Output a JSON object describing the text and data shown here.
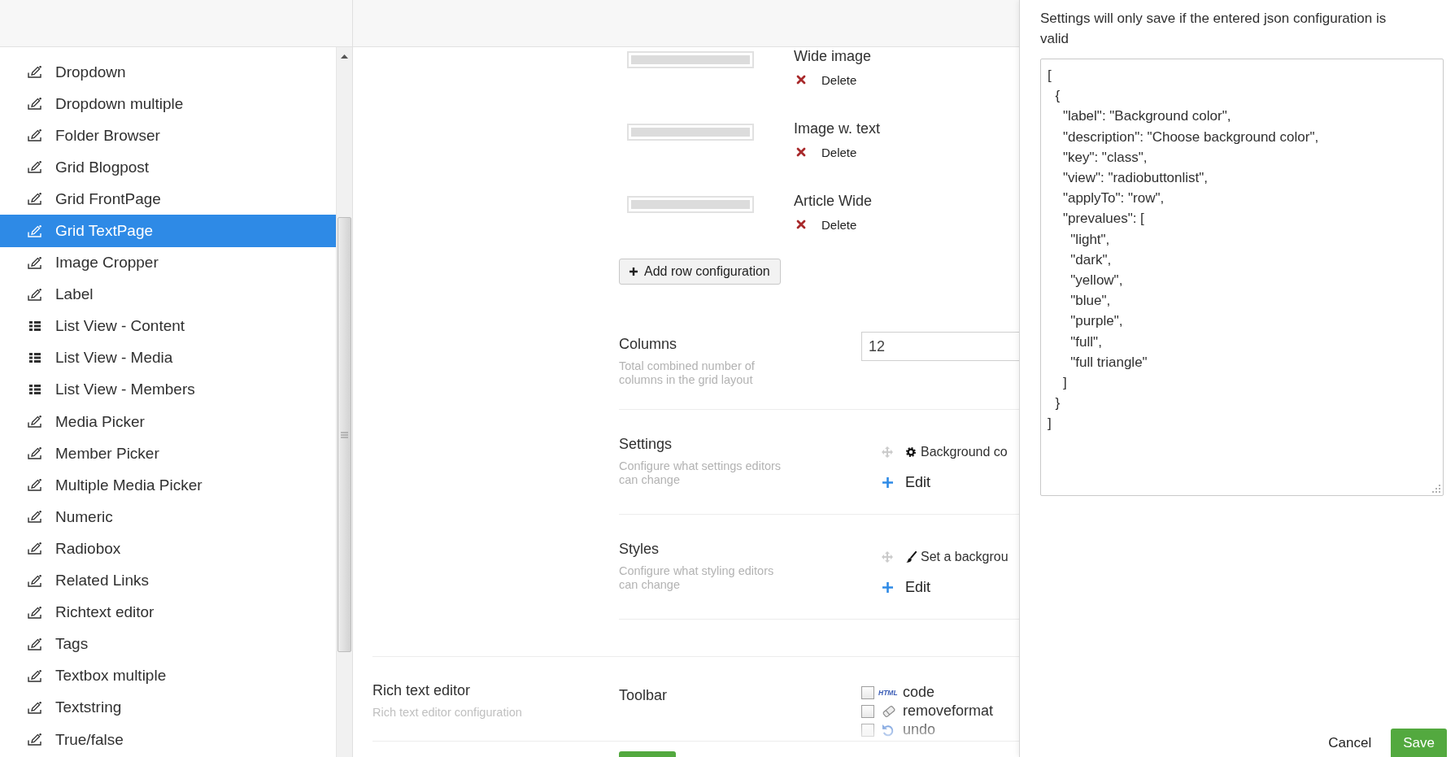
{
  "sidebar": {
    "items": [
      {
        "label": "Dropdown",
        "kind": "pencil",
        "selected": false
      },
      {
        "label": "Dropdown multiple",
        "kind": "pencil",
        "selected": false
      },
      {
        "label": "Folder Browser",
        "kind": "pencil",
        "selected": false
      },
      {
        "label": "Grid Blogpost",
        "kind": "pencil",
        "selected": false
      },
      {
        "label": "Grid FrontPage",
        "kind": "pencil",
        "selected": false
      },
      {
        "label": "Grid TextPage",
        "kind": "pencil",
        "selected": true
      },
      {
        "label": "Image Cropper",
        "kind": "pencil",
        "selected": false
      },
      {
        "label": "Label",
        "kind": "pencil",
        "selected": false
      },
      {
        "label": "List View - Content",
        "kind": "list",
        "selected": false
      },
      {
        "label": "List View - Media",
        "kind": "list",
        "selected": false
      },
      {
        "label": "List View - Members",
        "kind": "list",
        "selected": false
      },
      {
        "label": "Media Picker",
        "kind": "pencil",
        "selected": false
      },
      {
        "label": "Member Picker",
        "kind": "pencil",
        "selected": false
      },
      {
        "label": "Multiple Media Picker",
        "kind": "pencil",
        "selected": false
      },
      {
        "label": "Numeric",
        "kind": "pencil",
        "selected": false
      },
      {
        "label": "Radiobox",
        "kind": "pencil",
        "selected": false
      },
      {
        "label": "Related Links",
        "kind": "pencil",
        "selected": false
      },
      {
        "label": "Richtext editor",
        "kind": "pencil",
        "selected": false
      },
      {
        "label": "Tags",
        "kind": "pencil",
        "selected": false
      },
      {
        "label": "Textbox multiple",
        "kind": "pencil",
        "selected": false
      },
      {
        "label": "Textstring",
        "kind": "pencil",
        "selected": false
      },
      {
        "label": "True/false",
        "kind": "pencil",
        "selected": false
      }
    ]
  },
  "grid_editor": {
    "row_configurations": [
      {
        "name": "Wide image",
        "delete": "Delete"
      },
      {
        "name": "Image w. text",
        "delete": "Delete"
      },
      {
        "name": "Article Wide",
        "delete": "Delete"
      }
    ],
    "add_row_button": "Add row configuration",
    "columns": {
      "label": "Columns",
      "description": "Total combined number of columns in the grid layout",
      "value": "12"
    },
    "sections": [
      {
        "label": "Settings",
        "description": "Configure what settings editors can change",
        "entries": [
          {
            "label": "Background co",
            "kind": "gear"
          }
        ],
        "edit": "Edit"
      },
      {
        "label": "Styles",
        "description": "Configure what styling editors can change",
        "entries": [
          {
            "label": "Set a backgrou",
            "kind": "brush"
          }
        ],
        "edit": "Edit"
      }
    ]
  },
  "rich_text_editor": {
    "label": "Rich text editor",
    "description": "Rich text editor configuration",
    "toolbar": {
      "label": "Toolbar",
      "options": [
        {
          "label": "code",
          "kind": "html",
          "icon_text": "HTML",
          "checked": false
        },
        {
          "label": "removeformat",
          "kind": "eraser",
          "checked": false
        },
        {
          "label": "undo",
          "kind": "undo",
          "checked": false
        }
      ]
    }
  },
  "settings_dialog": {
    "message": "Settings will only save if the entered json configuration is valid",
    "json_value": "[\n  {\n    \"label\": \"Background color\",\n    \"description\": \"Choose background color\",\n    \"key\": \"class\",\n    \"view\": \"radiobuttonlist\",\n    \"applyTo\": \"row\",\n    \"prevalues\": [\n      \"light\",\n      \"dark\",\n      \"yellow\",\n      \"blue\",\n      \"purple\",\n      \"full\",\n      \"full triangle\"\n    ]\n  }\n]",
    "cancel": "Cancel",
    "save": "Save"
  }
}
